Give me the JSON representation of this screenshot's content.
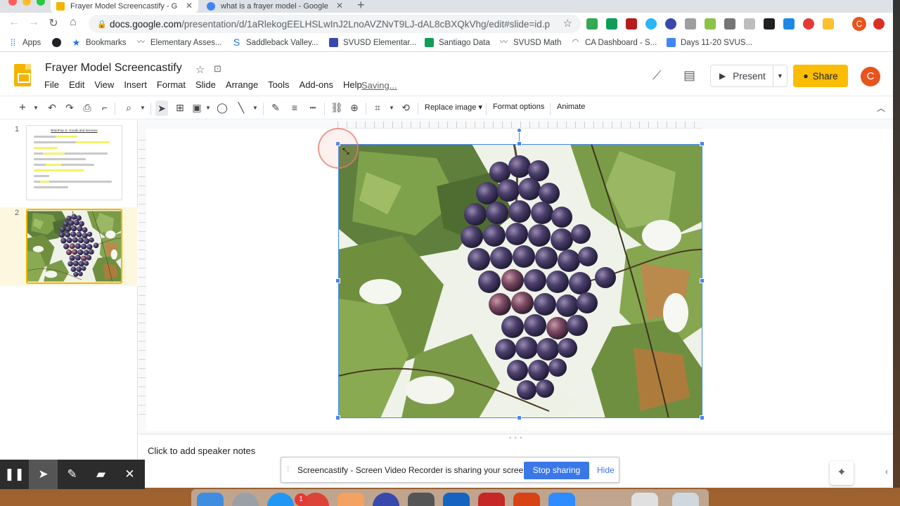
{
  "browser": {
    "tabs": [
      {
        "title": "Frayer Model Screencastify - G",
        "active": true
      },
      {
        "title": "what is a frayer model - Google",
        "active": false
      }
    ],
    "url_host": "docs.google.com",
    "url_path": "/presentation/d/1aRlekogEELHSLwInJ2LnoAVZNvT9LJ-dAL8cBXQkVhg/edit#slide=id.p",
    "bookmarks": [
      {
        "label": "Apps",
        "icon": "apps-grid-icon"
      },
      {
        "label": "",
        "icon": "globe-icon"
      },
      {
        "label": "Bookmarks",
        "icon": "star-icon"
      },
      {
        "label": "Elementary Asses...",
        "icon": "bird-icon"
      },
      {
        "label": "Saddleback Valley...",
        "icon": "s-logo-icon"
      },
      {
        "label": "SVUSD Elementar...",
        "icon": "form-icon"
      },
      {
        "label": "Santiago Data",
        "icon": "sheets-icon"
      },
      {
        "label": "SVUSD Math",
        "icon": "bird-icon"
      },
      {
        "label": "CA Dashboard - S...",
        "icon": "dashboard-icon"
      },
      {
        "label": "Days 11-20 SVUS...",
        "icon": "docs-icon"
      }
    ],
    "profile_initial": "C"
  },
  "app": {
    "title": "Frayer Model Screencastify",
    "menu": [
      "File",
      "Edit",
      "View",
      "Insert",
      "Format",
      "Slide",
      "Arrange",
      "Tools",
      "Add-ons",
      "Help"
    ],
    "status": "Saving...",
    "present_label": "Present",
    "share_label": "Share",
    "avatar_initial": "C"
  },
  "toolbar": {
    "replace_image": "Replace image",
    "format_options": "Format options",
    "animate": "Animate"
  },
  "filmstrip": {
    "slides": [
      {
        "number": "1",
        "thumb_title": "BrainPop Jr. Goods and Services"
      },
      {
        "number": "2",
        "selected": true
      }
    ]
  },
  "notes": {
    "placeholder": "Click to add speaker notes"
  },
  "screencastify": {
    "message": "Screencastify - Screen Video Recorder is sharing your screen.",
    "stop_label": "Stop sharing",
    "hide_label": "Hide"
  },
  "dock": {
    "badge_count": "1"
  },
  "colors": {
    "accent_blue": "#4285f4",
    "share_yellow": "#fbbc04",
    "stop_blue": "#3b78e7",
    "avatar_orange": "#e8541c"
  }
}
